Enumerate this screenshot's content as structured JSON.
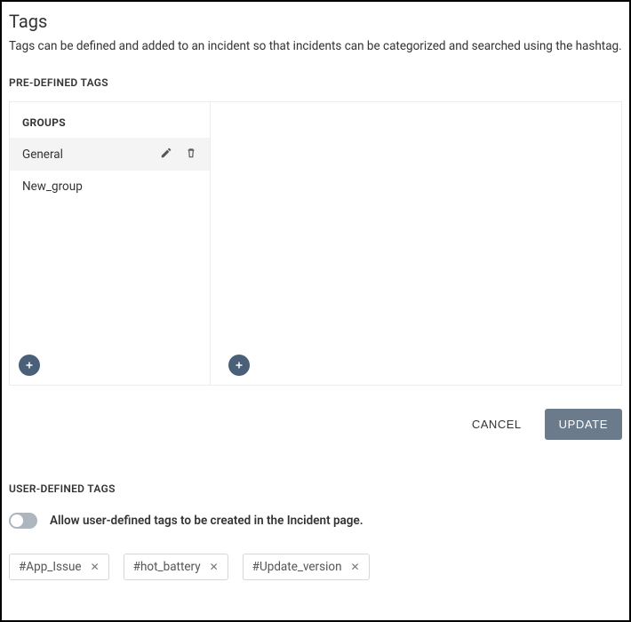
{
  "page": {
    "title": "Tags",
    "description": "Tags can be defined and added to an incident so that incidents can be categorized and searched using the hashtag."
  },
  "predefined": {
    "heading": "PRE-DEFINED TAGS",
    "groups_header": "GROUPS",
    "groups": [
      {
        "label": "General",
        "active": true
      },
      {
        "label": "New_group",
        "active": false
      }
    ]
  },
  "actions": {
    "cancel": "CANCEL",
    "update": "UPDATE"
  },
  "user_defined": {
    "heading": "USER-DEFINED TAGS",
    "toggle_label": "Allow user-defined tags to be created in the Incident page.",
    "toggle_on": false,
    "tags": [
      "#App_Issue",
      "#hot_battery",
      "#Update_version"
    ]
  }
}
